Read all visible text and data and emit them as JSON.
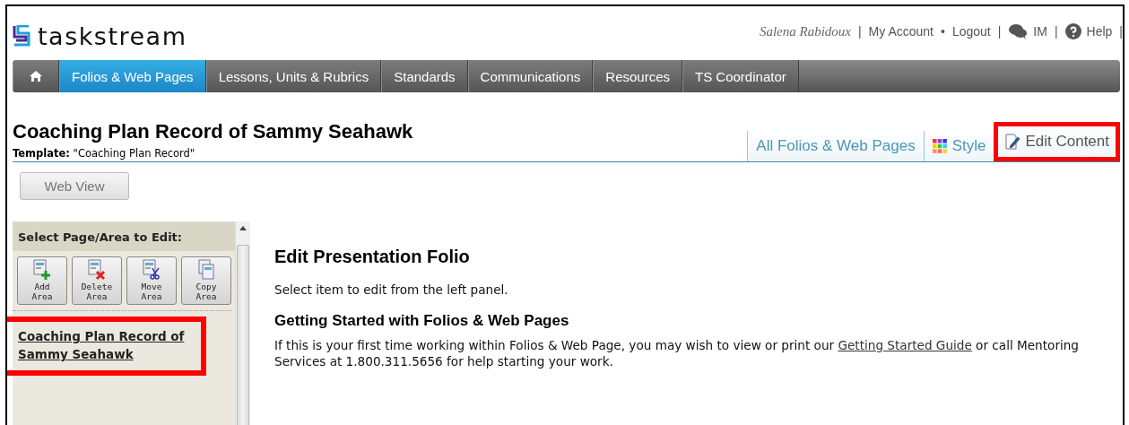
{
  "header": {
    "logo": "taskstream",
    "user_links": [
      {
        "kind": "user",
        "label": "Salena Rabidoux"
      },
      {
        "kind": "sep",
        "label": "|"
      },
      {
        "kind": "link",
        "label": "My Account"
      },
      {
        "kind": "sep",
        "label": "•"
      },
      {
        "kind": "link",
        "label": "Logout"
      },
      {
        "kind": "sep",
        "label": "|"
      },
      {
        "kind": "im",
        "label": "IM"
      },
      {
        "kind": "sep",
        "label": "|"
      },
      {
        "kind": "help",
        "label": "Help"
      },
      {
        "kind": "sep",
        "label": "|"
      }
    ]
  },
  "nav": [
    {
      "kind": "home",
      "selected": false
    },
    {
      "kind": "tab",
      "label": "Folios & Web Pages",
      "selected": true
    },
    {
      "kind": "tab",
      "label": "Lessons, Units & Rubrics",
      "selected": false
    },
    {
      "kind": "tab",
      "label": "Standards",
      "selected": false
    },
    {
      "kind": "tab",
      "label": "Communications",
      "selected": false
    },
    {
      "kind": "tab",
      "label": "Resources",
      "selected": false
    },
    {
      "kind": "tab",
      "label": "TS Coordinator",
      "selected": false
    }
  ],
  "page": {
    "title": "Coaching Plan Record of Sammy Seahawk",
    "template_label": "Template:",
    "template_value": "\"Coaching Plan Record\"",
    "tabs": [
      {
        "kind": "plain",
        "label": "All Folios & Web Pages",
        "highlighted": false
      },
      {
        "kind": "style",
        "label": "Style",
        "highlighted": false
      },
      {
        "kind": "edit",
        "label": "Edit Content",
        "highlighted": true
      }
    ],
    "web_view_button": "Web View"
  },
  "sidebar": {
    "title": "Select Page/Area to Edit:",
    "tools": [
      {
        "kind": "add",
        "label": "Add Area"
      },
      {
        "kind": "delete",
        "label": "Delete Area"
      },
      {
        "kind": "move",
        "label": "Move Area"
      },
      {
        "kind": "copy",
        "label": "Copy Area"
      }
    ],
    "items": [
      {
        "label": "Coaching Plan Record of Sammy Seahawk",
        "highlighted": true
      }
    ]
  },
  "main": {
    "heading": "Edit Presentation Folio",
    "intro": "Select item to edit from the left panel.",
    "subheading": "Getting Started with Folios & Web Pages",
    "paragraph_before": "If this is your first time working within Folios & Web Page, you may wish to view or print our ",
    "paragraph_link": "Getting Started Guide",
    "paragraph_after": " or call Mentoring Services at 1.800.311.5656 for help starting your work."
  }
}
